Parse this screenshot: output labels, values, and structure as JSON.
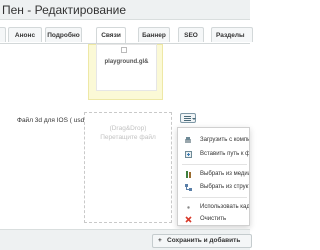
{
  "window": {
    "title": "Пен - Редактирование"
  },
  "tabs": [
    {
      "label": ""
    },
    {
      "label": "Анонс"
    },
    {
      "label": "Подробно"
    },
    {
      "label": "Связи"
    },
    {
      "label": "Баннер"
    },
    {
      "label": "SEO"
    },
    {
      "label": "Разделы"
    }
  ],
  "active_tab_index": 3,
  "preview": {
    "file_name": "playground.gl&"
  },
  "ios_field": {
    "label": "Файл 3d для IOS ( usdz):",
    "dropzone_line1": "(Drag&Drop)",
    "dropzone_line2": "Перетащите файл"
  },
  "menu": {
    "items": [
      {
        "label": "Загрузить с компьютера",
        "icon": "upload-icon"
      },
      {
        "label": "Вставить путь к файлу",
        "icon": "path-icon"
      },
      {
        "label": "Выбрать из медиабиблиотеки",
        "icon": "media-library-icon"
      },
      {
        "label": "Выбрать из структуры",
        "icon": "structure-icon"
      },
      {
        "label": "Использовать кадрирование",
        "icon": "crop-icon"
      },
      {
        "label": "Очистить",
        "icon": "clear-icon"
      }
    ]
  },
  "footer": {
    "save_add_label": "Сохранить и добавить"
  },
  "colors": {
    "header_bg": "#eef1f2",
    "preview_bg": "#fbf9d6",
    "clear_icon": "#d93a2b",
    "menu_button_border": "#7f98a6"
  }
}
